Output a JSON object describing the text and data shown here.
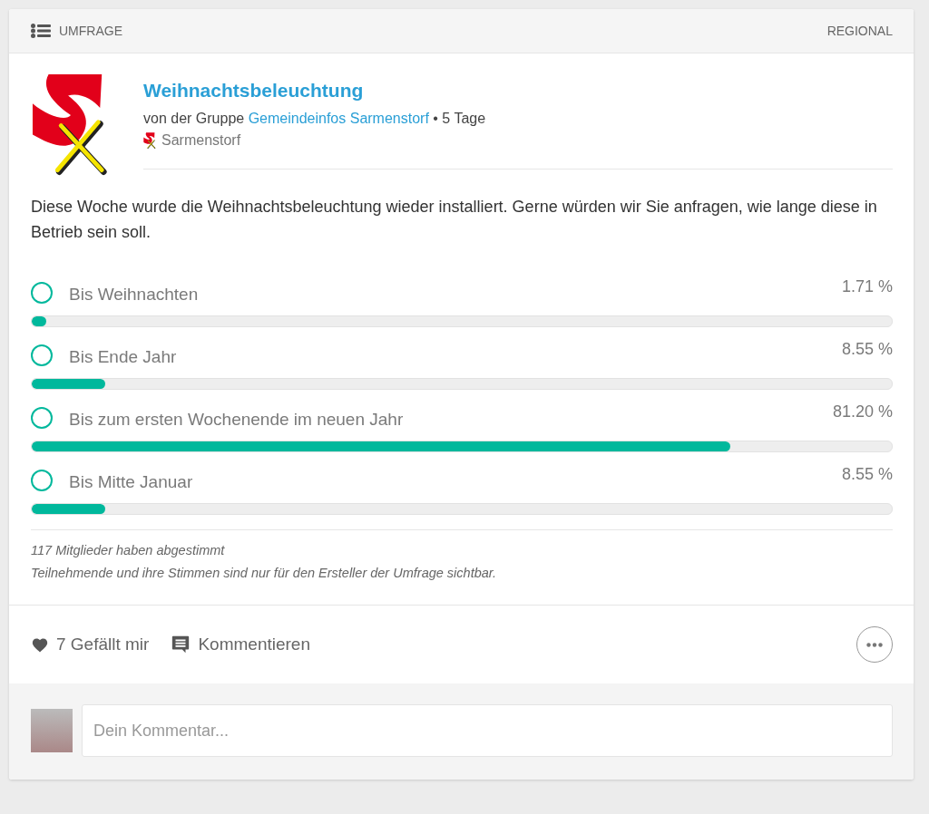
{
  "header": {
    "type": "UMFRAGE",
    "scope": "REGIONAL"
  },
  "post": {
    "title": "Weihnachtsbeleuchtung",
    "byline_prefix": "von der Gruppe",
    "group": "Gemeindeinfos Sarmenstorf",
    "age": "• 5 Tage",
    "location": "Sarmenstorf"
  },
  "description": "Diese Woche wurde die Weihnachtsbeleuchtung wieder installiert. Gerne würden wir Sie anfragen, wie lange diese in Betrieb sein soll.",
  "options": [
    {
      "label": "Bis Weihnachten",
      "percent": "1.71 %",
      "level": 0.0171,
      "selected": false
    },
    {
      "label": "Bis Ende Jahr",
      "percent": "8.55 %",
      "level": 0.0855,
      "selected": false
    },
    {
      "label": "Bis zum ersten Wochenende im neuen Jahr",
      "percent": "81.20 %",
      "level": 0.812,
      "selected": false
    },
    {
      "label": "Bis Mitte Januar",
      "percent": "8.55 %",
      "level": 0.0855,
      "selected": false
    }
  ],
  "notes": [
    "117 Mitglieder haben abgestimmt",
    "Teilnehmende und ihre Stimmen sind nur für den Ersteller der Umfrage sichtbar."
  ],
  "actions": {
    "like": "7 Gefällt mir",
    "comment": "Kommentieren"
  },
  "comment_field": {
    "placeholder": "Dein Kommentar..."
  }
}
